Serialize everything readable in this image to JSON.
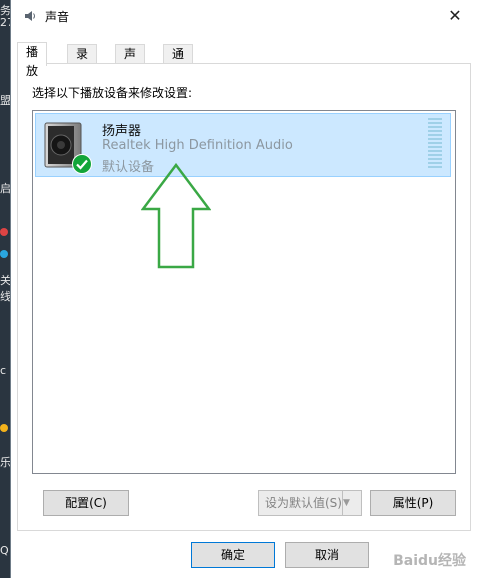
{
  "window": {
    "title": "声音",
    "close_label": "✕"
  },
  "tabs": [
    {
      "label": "播放",
      "active": true
    },
    {
      "label": "录制",
      "active": false
    },
    {
      "label": "声音",
      "active": false
    },
    {
      "label": "通信",
      "active": false
    }
  ],
  "playback": {
    "instruction": "选择以下播放设备来修改设置:",
    "devices": [
      {
        "name": "扬声器",
        "driver": "Realtek High Definition Audio",
        "status": "默认设备",
        "selected": true
      }
    ]
  },
  "panel_buttons": {
    "configure": "配置(C)",
    "set_default": "设为默认值(S)",
    "set_default_arrow": "▼",
    "properties": "属性(P)"
  },
  "dialog_buttons": {
    "ok": "确定",
    "cancel": "取消"
  },
  "desktop_fragments": [
    "务",
    "27",
    "盟",
    "启",
    "关",
    "线",
    "c",
    "乐",
    "Q"
  ],
  "watermark": "Baidu经验",
  "colors": {
    "selection": "#cce8ff",
    "check": "#12a539",
    "accent": "#0078d7"
  }
}
